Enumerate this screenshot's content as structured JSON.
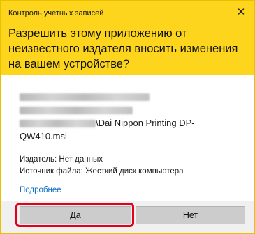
{
  "window": {
    "title": "Контроль учетных записей",
    "close_symbol": "✕"
  },
  "prompt": {
    "question": "Разрешить этому приложению от неизвестного издателя вносить изменения на вашем устройстве?"
  },
  "program": {
    "visible_name_part1": "\\Dai Nippon Printing DP-",
    "visible_name_part2": "QW410.msi"
  },
  "details": {
    "publisher": "Издатель: Нет данных",
    "source": "Источник файла: Жесткий диск компьютера"
  },
  "links": {
    "more": "Подробнее"
  },
  "buttons": {
    "yes": "Да",
    "no": "Нет"
  },
  "colors": {
    "header": "#fdd51c",
    "highlight": "#e3001b",
    "link": "#0f6fc6"
  }
}
